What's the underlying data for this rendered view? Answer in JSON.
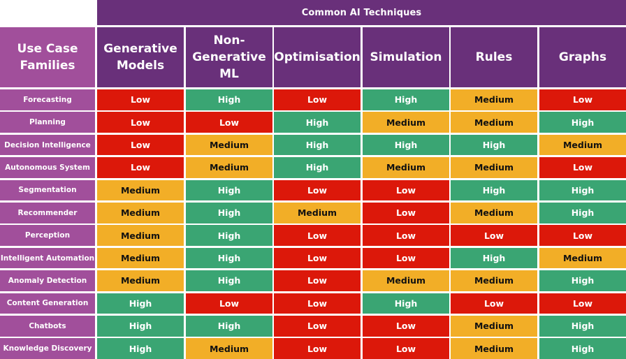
{
  "chart_data": {
    "type": "heatmap",
    "title": "Common AI Techniques",
    "row_header": "Use Case Families",
    "columns": [
      "Generative Models",
      "Non-Generative ML",
      "Optimisation",
      "Simulation",
      "Rules",
      "Graphs"
    ],
    "rows": [
      "Forecasting",
      "Planning",
      "Decision Intelligence",
      "Autonomous System",
      "Segmentation",
      "Recommender",
      "Perception",
      "Intelligent Automation",
      "Anomaly Detection",
      "Content Generation",
      "Chatbots",
      "Knowledge Discovery"
    ],
    "values": [
      [
        "Low",
        "High",
        "Low",
        "High",
        "Medium",
        "Low"
      ],
      [
        "Low",
        "Low",
        "High",
        "Medium",
        "Medium",
        "High"
      ],
      [
        "Low",
        "Medium",
        "High",
        "High",
        "High",
        "Medium"
      ],
      [
        "Low",
        "Medium",
        "High",
        "Medium",
        "Medium",
        "Low"
      ],
      [
        "Medium",
        "High",
        "Low",
        "Low",
        "High",
        "High"
      ],
      [
        "Medium",
        "High",
        "Medium",
        "Low",
        "Medium",
        "High"
      ],
      [
        "Medium",
        "High",
        "Low",
        "Low",
        "Low",
        "Low"
      ],
      [
        "Medium",
        "High",
        "Low",
        "Low",
        "High",
        "Medium"
      ],
      [
        "Medium",
        "High",
        "Low",
        "Medium",
        "Medium",
        "High"
      ],
      [
        "High",
        "Low",
        "Low",
        "High",
        "Low",
        "Low"
      ],
      [
        "High",
        "High",
        "Low",
        "Low",
        "Medium",
        "High"
      ],
      [
        "High",
        "Medium",
        "Low",
        "Low",
        "Medium",
        "High"
      ]
    ],
    "legend": {
      "Low": "#dc180a",
      "Medium": "#f2ae27",
      "High": "#3aa573"
    },
    "header_colors": {
      "technique_header": "#69307a",
      "use_case_header": "#a14f9b"
    }
  }
}
